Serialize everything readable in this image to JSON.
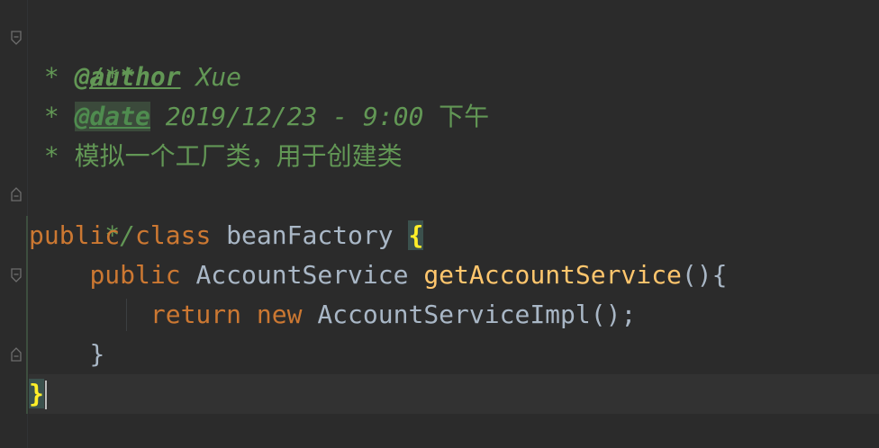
{
  "code_lines": {
    "l1": {
      "text": "/**"
    },
    "l2": {
      "star": " * ",
      "tag": "@author",
      "rest": " Xue"
    },
    "l3": {
      "star": " * ",
      "tag": "@date",
      "rest": " 2019/12/23 - 9:00 ",
      "cjk": "下午"
    },
    "l4": {
      "star": " * ",
      "cjk": "模拟一个工厂类，用于创建类"
    },
    "l5": {
      "text": " */"
    },
    "l6": {
      "kw1": "public",
      "kw2": "class",
      "name": "beanFactory",
      "brace": "{"
    },
    "l7": {
      "indent": "    ",
      "kw1": "public",
      "type": "AccountService",
      "method": "getAccountService",
      "tail": "(){"
    },
    "l8": {
      "indent": "        ",
      "kw1": "return",
      "kw2": "new",
      "call": "AccountServiceImpl",
      "tail": "();"
    },
    "l9": {
      "indent": "    ",
      "brace": "}"
    },
    "l10": {
      "brace": "}"
    }
  },
  "colors": {
    "background": "#2b2b2b",
    "comment": "#629755",
    "keyword": "#cc7832",
    "method": "#ffc66d",
    "identifier": "#a9b7c6",
    "brace_match": "#ffef28"
  }
}
